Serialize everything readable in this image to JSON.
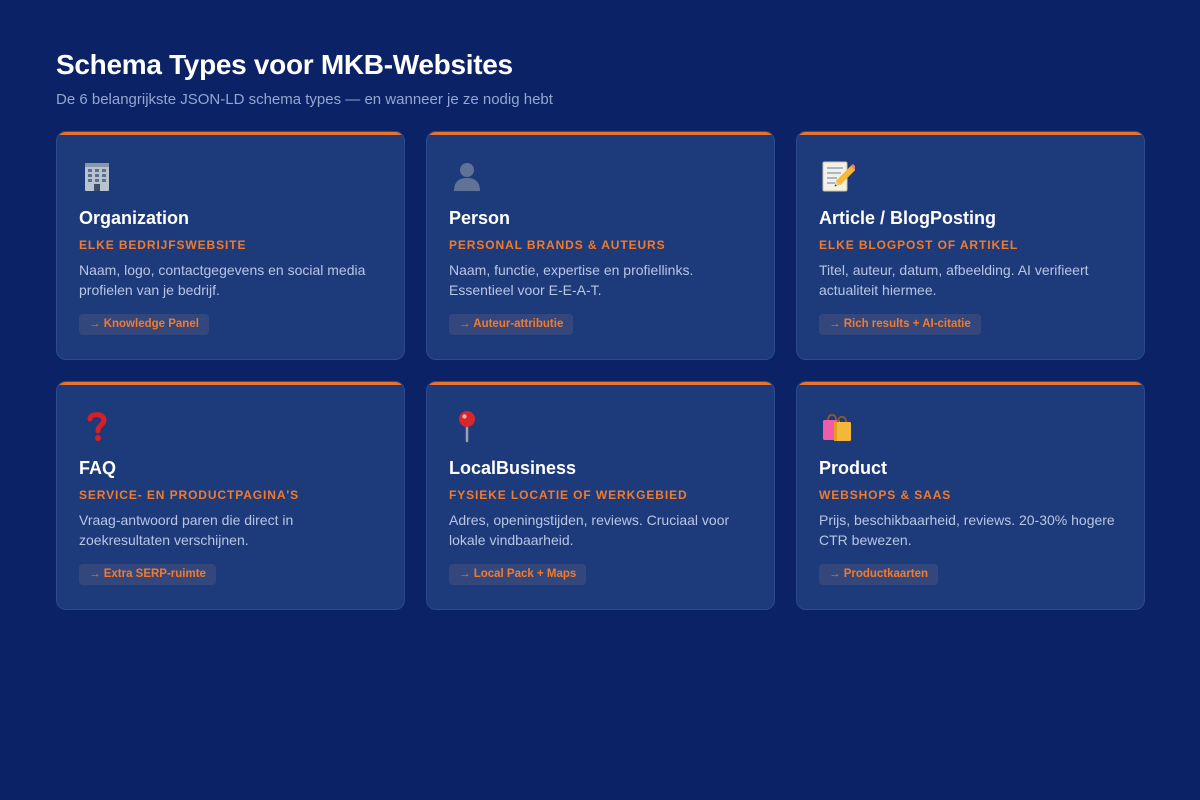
{
  "header": {
    "title": "Schema Types voor MKB-Websites",
    "subtitle": "De 6 belangrijkste JSON-LD schema types — en wanneer je ze nodig hebt"
  },
  "colors": {
    "background": "#0b2266",
    "card": "#1d3a7a",
    "accent": "#e8742a"
  },
  "cards": [
    {
      "icon": "office-building-icon",
      "title": "Organization",
      "tag": "Elke bedrijfswebsite",
      "description": "Naam, logo, contactgegevens en social media profielen van je bedrijf.",
      "badge": "→ Knowledge Panel"
    },
    {
      "icon": "person-silhouette-icon",
      "title": "Person",
      "tag": "Personal brands & auteurs",
      "description": "Naam, functie, expertise en profiellinks. Essentieel voor E-E-A-T.",
      "badge": "→ Auteur-attributie"
    },
    {
      "icon": "memo-pencil-icon",
      "title": "Article / BlogPosting",
      "tag": "Elke blogpost of artikel",
      "description": "Titel, auteur, datum, afbeelding. AI verifieert actualiteit hiermee.",
      "badge": "→ Rich results + AI-citatie"
    },
    {
      "icon": "question-mark-icon",
      "title": "FAQ",
      "tag": "Service- en productpagina's",
      "description": "Vraag-antwoord paren die direct in zoekresultaten verschijnen.",
      "badge": "→ Extra SERP-ruimte"
    },
    {
      "icon": "map-pin-icon",
      "title": "LocalBusiness",
      "tag": "Fysieke locatie of werkgebied",
      "description": "Adres, openingstijden, reviews. Cruciaal voor lokale vindbaarheid.",
      "badge": "→ Local Pack + Maps"
    },
    {
      "icon": "shopping-bags-icon",
      "title": "Product",
      "tag": "Webshops & SaaS",
      "description": "Prijs, beschikbaarheid, reviews. 20-30% hogere CTR bewezen.",
      "badge": "→ Productkaarten"
    }
  ]
}
